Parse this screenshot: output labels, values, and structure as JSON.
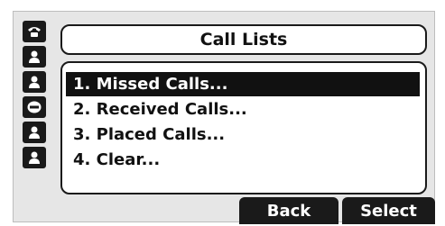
{
  "title": "Call Lists",
  "line_keys": [
    {
      "icon": "phone-handset-icon"
    },
    {
      "icon": "contact-icon"
    },
    {
      "icon": "contact-icon"
    },
    {
      "icon": "minus-circle-icon"
    },
    {
      "icon": "contact-icon"
    },
    {
      "icon": "contact-icon"
    }
  ],
  "menu": {
    "items": [
      {
        "label": "1. Missed Calls...",
        "selected": true
      },
      {
        "label": "2. Received Calls...",
        "selected": false
      },
      {
        "label": "3. Placed Calls...",
        "selected": false
      },
      {
        "label": "4. Clear...",
        "selected": false
      }
    ]
  },
  "softkeys": {
    "back": "Back",
    "select": "Select"
  },
  "colors": {
    "screen_bg": "#e6e6e6",
    "ink": "#1a1a1a",
    "highlight": "#111111"
  }
}
